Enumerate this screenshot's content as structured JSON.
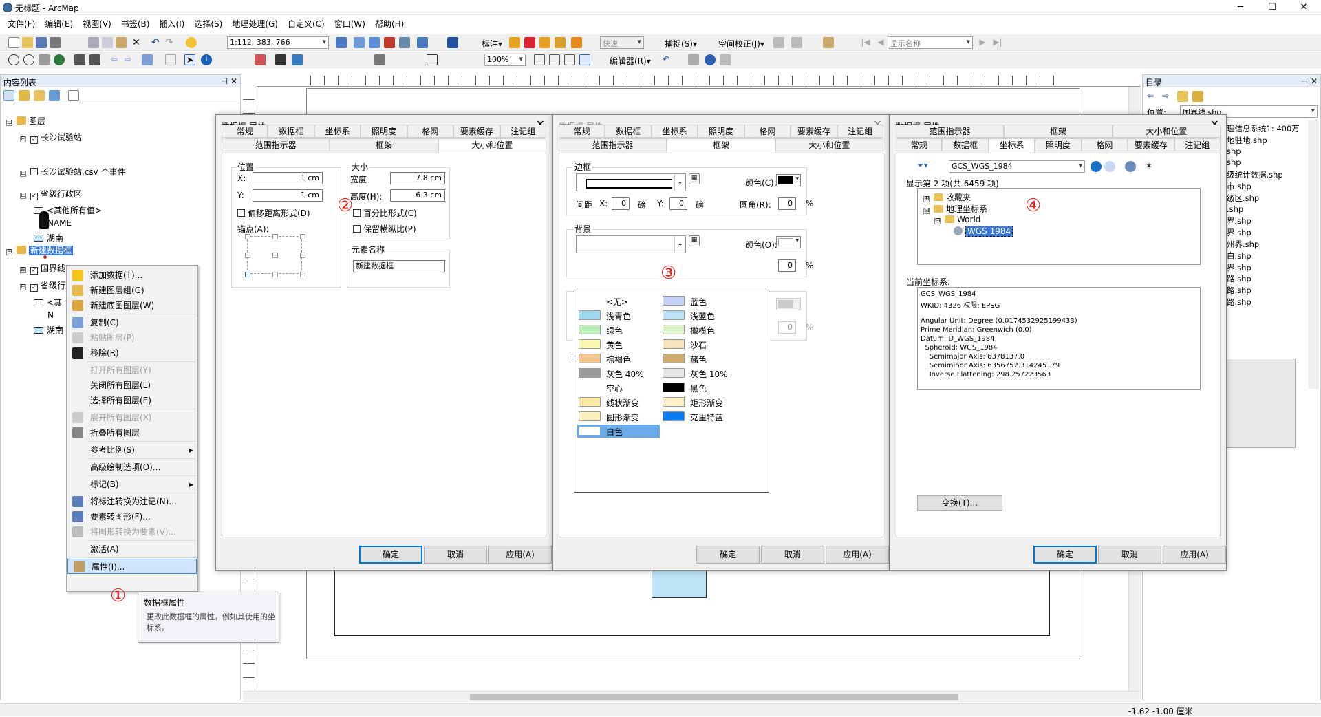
{
  "window": {
    "title": "无标题 - ArcMap",
    "min": "─",
    "max": "☐",
    "close": "✕"
  },
  "menu": [
    "文件(F)",
    "编辑(E)",
    "视图(V)",
    "书签(B)",
    "插入(I)",
    "选择(S)",
    "地理处理(G)",
    "自定义(C)",
    "窗口(W)",
    "帮助(H)"
  ],
  "toolbar": {
    "scale": "1:112, 383, 766",
    "label_tool": "标注▾",
    "fast": "快速",
    "snap": "捕捉(S)▾",
    "spatial_adjust": "空间校正(J)▾",
    "show_name": "显示名称",
    "zoom": "100%",
    "editor": "编辑器(R)▾"
  },
  "toc": {
    "title": "内容列表",
    "pin": "⊣ ✕",
    "items": [
      {
        "label": "图层",
        "level": 0,
        "exp": "⊟",
        "checkbox": null,
        "icon": "layers"
      },
      {
        "label": "长沙试验站",
        "level": 1,
        "exp": "⊟",
        "checkbox": "✓",
        "icon": null
      },
      {
        "label": "长沙试验站.csv 个事件",
        "level": 1,
        "exp": "⊟",
        "checkbox": "",
        "icon": null
      },
      {
        "label": "省级行政区",
        "level": 1,
        "exp": "⊟",
        "checkbox": "✓",
        "icon": null
      },
      {
        "label": "<其他所有值>",
        "level": 2,
        "exp": null,
        "checkbox": null,
        "icon": "box"
      },
      {
        "label": "NAME",
        "level": 3,
        "exp": null,
        "checkbox": null,
        "icon": null
      },
      {
        "label": "湖南",
        "level": 2,
        "exp": null,
        "checkbox": null,
        "icon": "blue"
      },
      {
        "label": "新建数据框",
        "level": 0,
        "exp": "⊟",
        "checkbox": null,
        "icon": "layers",
        "selected": true
      },
      {
        "label": "国界线",
        "level": 1,
        "exp": "⊟",
        "checkbox": "✓",
        "icon": null
      },
      {
        "label": "省级行政区",
        "level": 1,
        "exp": "⊟",
        "checkbox": "✓",
        "icon": null
      },
      {
        "label": "<其",
        "level": 2,
        "exp": null,
        "checkbox": null,
        "icon": "box"
      },
      {
        "label": "N",
        "level": 3,
        "exp": null,
        "checkbox": null,
        "icon": null
      },
      {
        "label": "湖南",
        "level": 2,
        "exp": null,
        "checkbox": null,
        "icon": "blue"
      }
    ]
  },
  "context_menu": [
    {
      "label": "添加数据(T)...",
      "icon": "#f5c518",
      "dis": false
    },
    {
      "label": "新建图层组(G)",
      "icon": "#e8b84a",
      "dis": false
    },
    {
      "label": "新建底图图层(W)",
      "icon": "#d9a441",
      "dis": false,
      "sep": true
    },
    {
      "label": "复制(C)",
      "icon": "#7aa0d8",
      "dis": false
    },
    {
      "label": "粘贴图层(P)",
      "icon": "#ccc",
      "dis": true
    },
    {
      "label": "移除(R)",
      "icon": "#222",
      "dis": false,
      "sep": true
    },
    {
      "label": "打开所有图层(Y)",
      "icon": null,
      "dis": true
    },
    {
      "label": "关闭所有图层(L)",
      "icon": null,
      "dis": false
    },
    {
      "label": "选择所有图层(E)",
      "icon": null,
      "dis": false,
      "sep": true
    },
    {
      "label": "展开所有图层(X)",
      "icon": "#ccc",
      "dis": true
    },
    {
      "label": "折叠所有图层",
      "icon": "#888",
      "dis": false,
      "sep": true
    },
    {
      "label": "参考比例(S)",
      "icon": null,
      "dis": false,
      "sub": true,
      "sep": true
    },
    {
      "label": "高级绘制选项(O)...",
      "icon": null,
      "dis": false,
      "sep": true
    },
    {
      "label": "标记(B)",
      "icon": null,
      "dis": false,
      "sub": true,
      "sep": true
    },
    {
      "label": "将标注转换为注记(N)...",
      "icon": "#5a7fb8",
      "dis": false
    },
    {
      "label": "要素转图形(F)...",
      "icon": "#5a7fb8",
      "dis": false
    },
    {
      "label": "将图形转换为要素(V)...",
      "icon": "#bbb",
      "dis": true,
      "sep": true
    },
    {
      "label": "激活(A)",
      "icon": null,
      "dis": false,
      "sep": true
    },
    {
      "label": "属性(I)...",
      "icon": "#c0a060",
      "dis": false,
      "hl": true
    }
  ],
  "tooltip": {
    "title": "数据框属性",
    "body": "更改此数据框的属性，例如其使用的坐标系。"
  },
  "markers": [
    "①",
    "②",
    "③",
    "④"
  ],
  "dialog": {
    "title": "数据框 属性",
    "ok": "确定",
    "cancel": "取消",
    "apply": "应用(A)",
    "close": "✕"
  },
  "dialog1": {
    "tabs_row1": [
      "常规",
      "数据框",
      "坐标系",
      "照明度",
      "格网",
      "要素缓存",
      "注记组"
    ],
    "tabs_row2": [
      "范围指示器",
      "框架",
      "大小和位置"
    ],
    "position": {
      "title": "位置",
      "x_label": "X:",
      "x": "1 cm",
      "y_label": "Y:",
      "y": "1 cm",
      "offset": "偏移距离形式(D)",
      "anchor": "锚点(A):"
    },
    "size": {
      "title": "大小",
      "w_label": "宽度",
      "w": "7.8 cm",
      "h_label": "高度(H):",
      "h": "6.3 cm",
      "percent": "百分比形式(C)",
      "keep": "保留横纵比(P)"
    },
    "element": {
      "title": "元素名称",
      "value": "新建数据框"
    }
  },
  "dialog2": {
    "tabs_row1": [
      "常规",
      "数据框",
      "坐标系",
      "照明度",
      "格网",
      "要素缓存",
      "注记组"
    ],
    "tabs_row2": [
      "范围指示器",
      "框架",
      "大小和位置"
    ],
    "border": {
      "title": "边框",
      "color": "颜色(C):",
      "gap": "间距",
      "x": "X:",
      "xv": "0",
      "y": "Y:",
      "yv": "0",
      "unit": "磅",
      "corner": "圆角(R):",
      "cv": "0",
      "pct": "%"
    },
    "background": {
      "title": "背景",
      "color": "颜色(O):",
      "cv": "0",
      "pct": "%"
    },
    "palette": [
      {
        "l": "<无>",
        "c": null
      },
      {
        "l": "蓝色",
        "c": "#c5d3f7"
      },
      {
        "l": "浅青色",
        "c": "#9fd8ee"
      },
      {
        "l": "浅蓝色",
        "c": "#bfe3f6"
      },
      {
        "l": "绿色",
        "c": "#b9efb9"
      },
      {
        "l": "橄榄色",
        "c": "#ddf3c8"
      },
      {
        "l": "黄色",
        "c": "#fbf5b4"
      },
      {
        "l": "沙石",
        "c": "#f6e4bd"
      },
      {
        "l": "棕褐色",
        "c": "#f2c58d"
      },
      {
        "l": "赭色",
        "c": "#cfaa6e"
      },
      {
        "l": "灰色 40%",
        "c": "#999999"
      },
      {
        "l": "灰色 10%",
        "c": "#e6e6e6"
      },
      {
        "l": "空心",
        "c": null
      },
      {
        "l": "黑色",
        "c": "#000000"
      },
      {
        "l": "线状渐变",
        "c": "#fce9a6"
      },
      {
        "l": "矩形渐变",
        "c": "#fdf2c8"
      },
      {
        "l": "圆形渐变",
        "c": "#fdf0bd"
      },
      {
        "l": "克里特蓝",
        "c": "#0a7cf0"
      },
      {
        "l": "白色",
        "c": "#ffffff",
        "sel": true
      }
    ]
  },
  "dialog3": {
    "tabs_row1": [
      "范围指示器",
      "框架",
      "大小和位置"
    ],
    "tabs_row2": [
      "常规",
      "数据框",
      "坐标系",
      "照明度",
      "格网",
      "要素缓存",
      "注记组"
    ],
    "search": "GCS_WGS_1984",
    "count": "显示第 2 项(共 6459 项)",
    "tree": [
      {
        "l": "收藏夹",
        "lv": 0,
        "e": "⊞"
      },
      {
        "l": "地理坐标系",
        "lv": 0,
        "e": "⊟"
      },
      {
        "l": "World",
        "lv": 1,
        "e": "⊟"
      },
      {
        "l": "WGS 1984",
        "lv": 2,
        "e": null,
        "sel": true
      }
    ],
    "current_label": "当前坐标系:",
    "details": [
      "GCS_WGS_1984",
      "WKID: 4326 权限: EPSG",
      "",
      "Angular Unit: Degree (0.0174532925199433)",
      "Prime Meridian: Greenwich (0.0)",
      "Datum: D_WGS_1984",
      "  Spheroid: WGS_1984",
      "    Semimajor Axis: 6378137.0",
      "    Semiminor Axis: 6356752.314245179",
      "    Inverse Flattening: 298.257223563"
    ],
    "transform": "变换(T)..."
  },
  "catalog": {
    "title": "目录",
    "location": "位置:",
    "loc_value": "国界线.shp",
    "files": [
      "理信息系统1: 400万",
      "地驻地.shp",
      "shp",
      "shp",
      "级统计数据.shp",
      "市.shp",
      "级区.shp",
      ".shp",
      "界.shp",
      "界.shp",
      "州界.shp",
      "白.shp",
      "界.shp",
      "路.shp",
      "路.shp",
      "路.shp"
    ],
    "stub": "hp"
  },
  "status": {
    "coords": "-1.62  -1.00 厘米"
  }
}
